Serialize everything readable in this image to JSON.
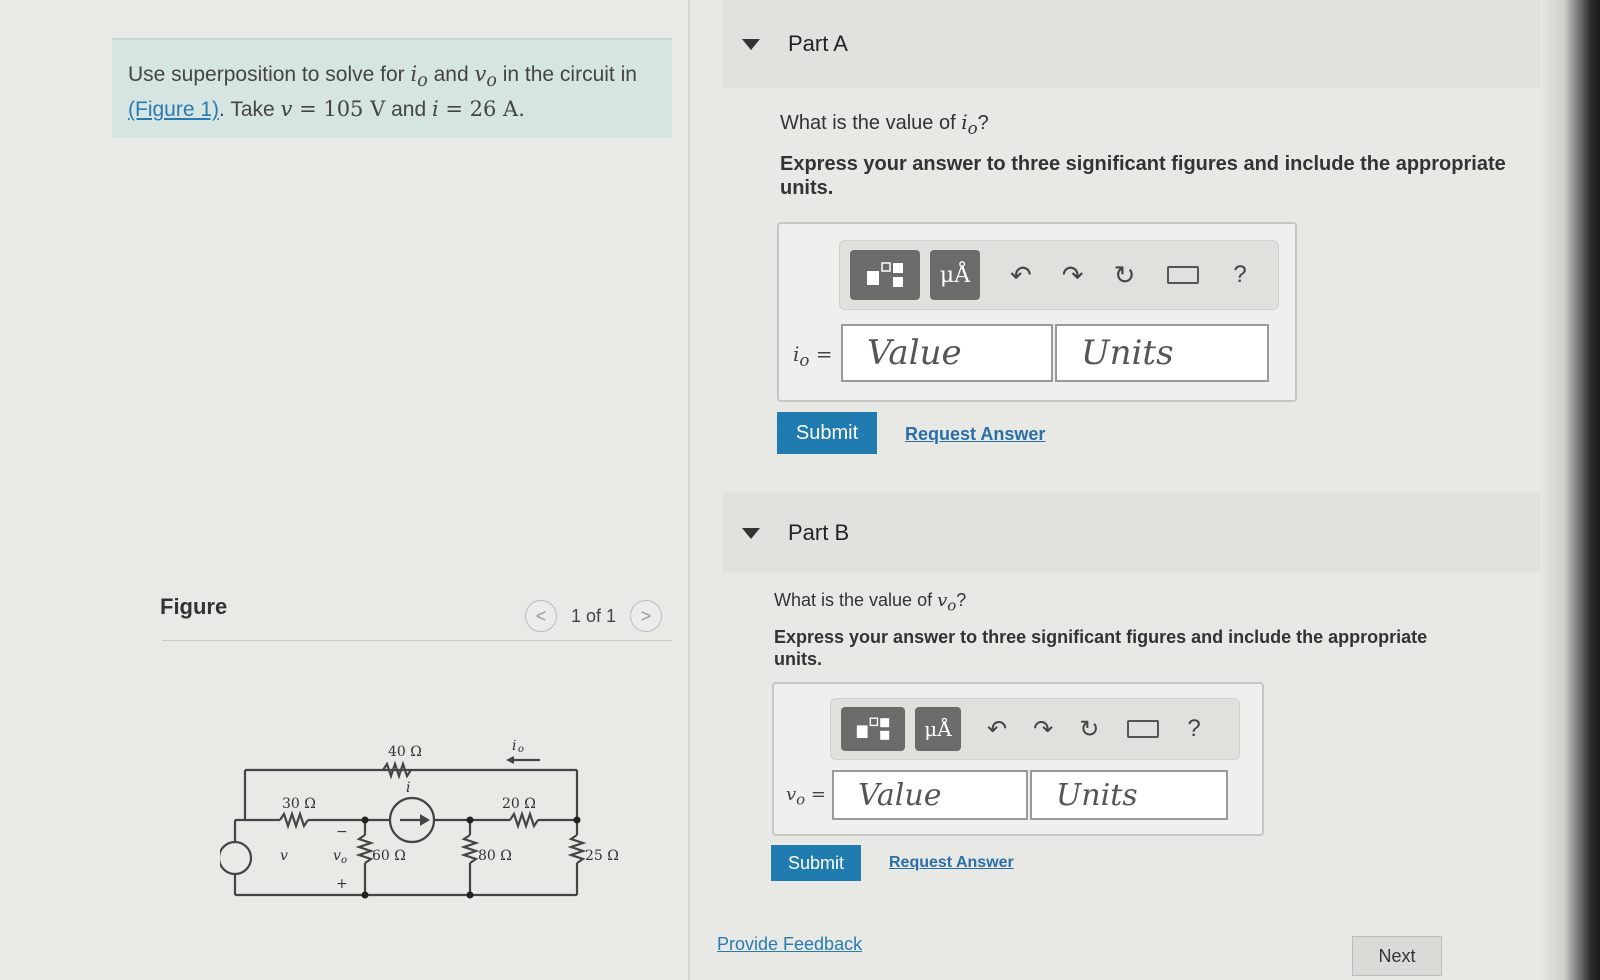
{
  "problem": {
    "text_before": "Use superposition to solve for ",
    "io": "i",
    "io_sub": "o",
    "text_and": " and ",
    "vo": "v",
    "vo_sub": "o",
    "text_in": " in the circuit in",
    "figure_link": "(Figure 1)",
    "take": ". Take ",
    "v_var": "v",
    "v_val": " = 105 V",
    "and2": " and ",
    "i_var": "i",
    "i_val": " = 26 A."
  },
  "figure": {
    "label": "Figure",
    "pager": "1 of 1",
    "prev": "<",
    "next": ">",
    "circuit_labels": {
      "r40": "40 Ω",
      "r30": "30 Ω",
      "r20": "20 Ω",
      "r60": "60 Ω",
      "r80": "80 Ω",
      "r25": "25 Ω",
      "src_i": "i",
      "src_v": "v",
      "io": "i",
      "io_sub": "o",
      "vo": "v",
      "vo_sub": "o",
      "plus": "+",
      "minus": "−"
    }
  },
  "part_a": {
    "title": "Part A",
    "question_pre": "What is the value of ",
    "var": "i",
    "var_sub": "o",
    "question_post": "?",
    "instruction": "Express your answer to three significant figures and include the appropriate units.",
    "eq_label": "i",
    "eq_sub": "o",
    "eq_sign": " =",
    "value_placeholder": "Value",
    "units_placeholder": "Units",
    "unit_btn": "μÅ",
    "help": "?",
    "submit": "Submit",
    "request": "Request Answer"
  },
  "part_b": {
    "title": "Part B",
    "question_pre": "What is the value of ",
    "var": "v",
    "var_sub": "o",
    "question_post": "?",
    "instruction": "Express your answer to three significant figures and include the appropriate units.",
    "eq_label": "v",
    "eq_sub": "o",
    "eq_sign": " =",
    "value_placeholder": "Value",
    "units_placeholder": "Units",
    "unit_btn": "μÅ",
    "help": "?",
    "submit": "Submit",
    "request": "Request Answer"
  },
  "footer": {
    "feedback": "Provide Feedback",
    "next": "Next"
  }
}
